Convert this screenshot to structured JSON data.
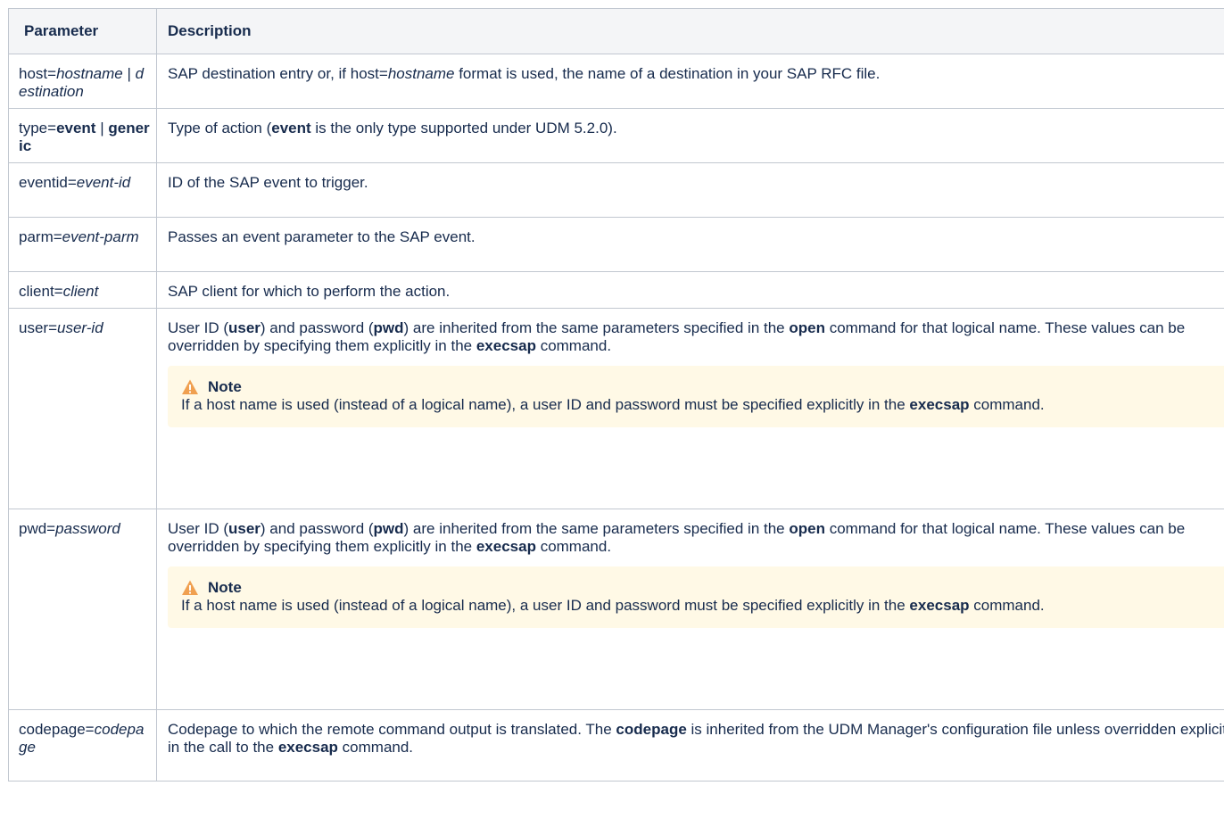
{
  "headers": {
    "parameter": "Parameter",
    "description": "Description"
  },
  "rows": [
    {
      "param": [
        "host=",
        {
          "i": "hostname"
        },
        " | ",
        {
          "i": "destination"
        }
      ],
      "desc": [
        "SAP destination entry or, if host=",
        {
          "i": "hostname"
        },
        " format is used, the name of a destination in your SAP RFC file."
      ]
    },
    {
      "param": [
        "type=",
        {
          "b": "event"
        },
        " | ",
        {
          "b": "generic"
        }
      ],
      "desc": [
        "Type of action (",
        {
          "b": "event"
        },
        " is the only type supported under UDM 5.2.0)."
      ]
    },
    {
      "param": [
        "eventid=",
        {
          "i": "event-id"
        }
      ],
      "desc": [
        "ID of the SAP event to trigger."
      ]
    },
    {
      "param": [
        "parm=",
        {
          "i": "event-parm"
        }
      ],
      "desc": [
        "Passes an event parameter to the SAP event."
      ]
    },
    {
      "param": [
        "client=",
        {
          "i": "client"
        }
      ],
      "desc": [
        "SAP client for which to perform the action."
      ]
    },
    {
      "param": [
        "user=",
        {
          "i": "user-id"
        }
      ],
      "desc": [
        "User ID (",
        {
          "b": "user"
        },
        ") and password (",
        {
          "b": "pwd"
        },
        ") are inherited from the same parameters specified in the ",
        {
          "b": "open"
        },
        " command for that logical name. These values can be overridden by specifying them explicitly in the ",
        {
          "b": "execsap"
        },
        " command."
      ],
      "note": {
        "title": "Note",
        "text": [
          "If a host name is used (instead of a logical name), a user ID and password must be specified explicitly in the ",
          {
            "b": "execsap"
          },
          " command."
        ]
      }
    },
    {
      "param": [
        "pwd=",
        {
          "i": "password"
        }
      ],
      "desc": [
        "User ID (",
        {
          "b": "user"
        },
        ") and password (",
        {
          "b": "pwd"
        },
        ") are inherited from the same parameters specified in the ",
        {
          "b": "open"
        },
        " command for that logical name. These values can be overridden by specifying them explicitly in the ",
        {
          "b": "execsap"
        },
        " command."
      ],
      "note": {
        "title": "Note",
        "text": [
          "If a host name is used (instead of a logical name), a user ID and password must be specified explicitly in the ",
          {
            "b": "execsap"
          },
          " command."
        ]
      }
    },
    {
      "param": [
        "codepage=",
        {
          "i": "codepage"
        }
      ],
      "desc": [
        "Codepage to which the remote command output is translated. The ",
        {
          "b": "codepage"
        },
        " is inherited from the UDM Manager's configuration file unless overridden explicitly in the call to the ",
        {
          "b": "execsap"
        },
        " command."
      ]
    }
  ],
  "icons": {
    "note": "warning-icon"
  },
  "colors": {
    "header_bg": "#f4f5f7",
    "note_bg": "#fff9e6",
    "border": "#c1c7d0",
    "warning": "#f0a050"
  }
}
